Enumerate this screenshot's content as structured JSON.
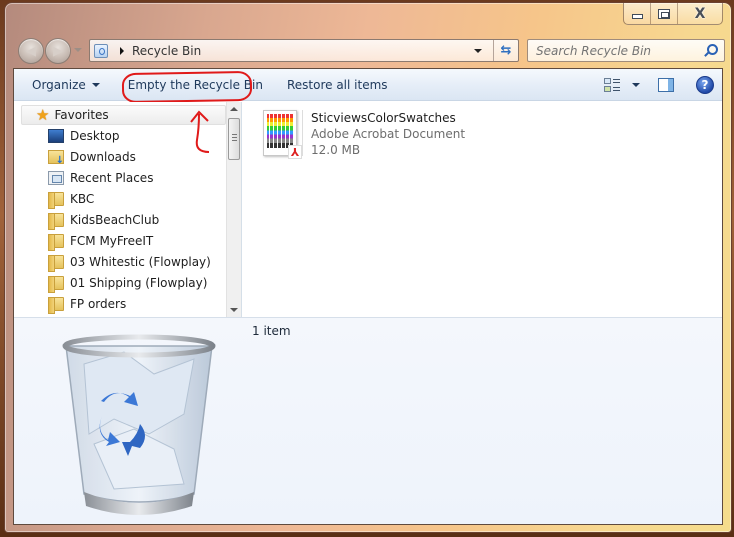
{
  "window": {
    "caption_buttons": {
      "minimize": "minimize",
      "maximize": "maximize",
      "close": "X"
    }
  },
  "navigation": {
    "back_icon": "back-arrow-icon",
    "forward_icon": "forward-arrow-icon",
    "address": {
      "location": "Recycle Bin",
      "icon": "recycle-bin-icon"
    },
    "refresh_icon": "refresh-icon",
    "search": {
      "placeholder": "Search Recycle Bin",
      "value": ""
    }
  },
  "toolbar": {
    "organize_label": "Organize",
    "empty_label": "Empty the Recycle Bin",
    "restore_label": "Restore all items",
    "views_icon": "change-view-icon",
    "preview_icon": "preview-pane-icon",
    "help_icon": "?"
  },
  "sidebar": {
    "favorites_label": "Favorites",
    "items": [
      {
        "label": "Desktop",
        "icon": "desktop-icon"
      },
      {
        "label": "Downloads",
        "icon": "downloads-icon"
      },
      {
        "label": "Recent Places",
        "icon": "recent-places-icon"
      },
      {
        "label": "KBC",
        "icon": "folder-icon"
      },
      {
        "label": "KidsBeachClub",
        "icon": "folder-icon"
      },
      {
        "label": "FCM MyFreeIT",
        "icon": "folder-icon"
      },
      {
        "label": "03 Whitestic (Flowplay)",
        "icon": "folder-icon"
      },
      {
        "label": "01 Shipping (Flowplay)",
        "icon": "folder-icon"
      },
      {
        "label": "FP orders",
        "icon": "folder-icon"
      }
    ]
  },
  "files": [
    {
      "name": "SticviewsColorSwatches",
      "type": "Adobe Acrobat Document",
      "size": "12.0 MB",
      "icon": "pdf-icon"
    }
  ],
  "details": {
    "item_count": "1 item"
  },
  "annotations": {
    "highlight_color": "#e01a1a",
    "highlighted_target": "Empty the Recycle Bin"
  }
}
